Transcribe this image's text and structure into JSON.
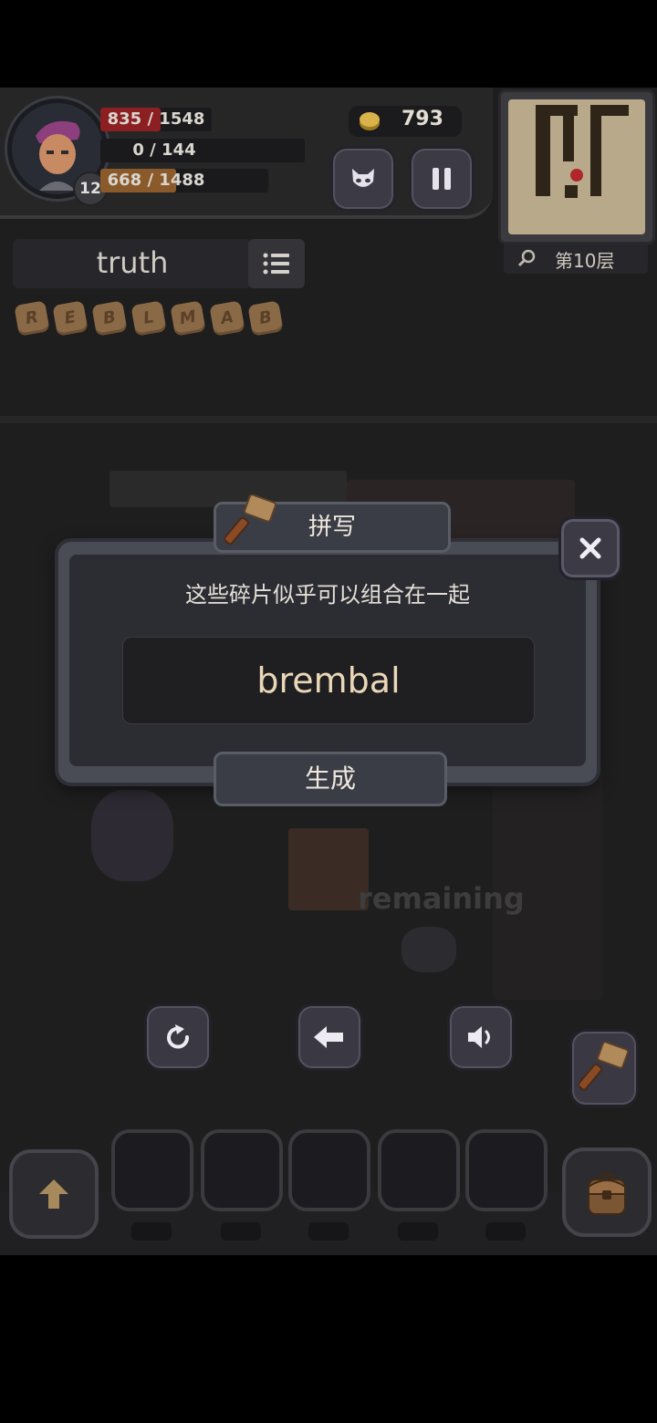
{
  "hud": {
    "hp_text": "835 / 1548",
    "hp_fraction": 0.54,
    "mp_text": "0 / 144",
    "mp_fraction": 0.0,
    "xp_text": "668 / 1488",
    "xp_fraction": 0.45,
    "level": "12",
    "gold": "793",
    "floor_label": "第10层",
    "colors": {
      "hp": "#8c1f22",
      "xp": "#8a5a2a",
      "gold": "#c9a13b"
    }
  },
  "word_panel": {
    "current_word": "truth",
    "runes": [
      "R",
      "E",
      "B",
      "L",
      "M",
      "A",
      "B"
    ]
  },
  "dialog": {
    "tab_title": "拼写",
    "message": "这些碎片似乎可以组合在一起",
    "spelled_word": "brembal",
    "generate_label": "生成"
  },
  "background": {
    "faded_text": "remaining"
  },
  "icons": {
    "pause": "pause-icon",
    "monster": "monster-face-icon",
    "search": "search-icon",
    "list": "list-icon",
    "hammer": "hammer-icon",
    "close": "close-icon",
    "undo": "undo-icon",
    "backspace": "backspace-arrow-icon",
    "sound": "speaker-icon",
    "up": "up-arrow-icon",
    "bag": "backpack-icon"
  }
}
